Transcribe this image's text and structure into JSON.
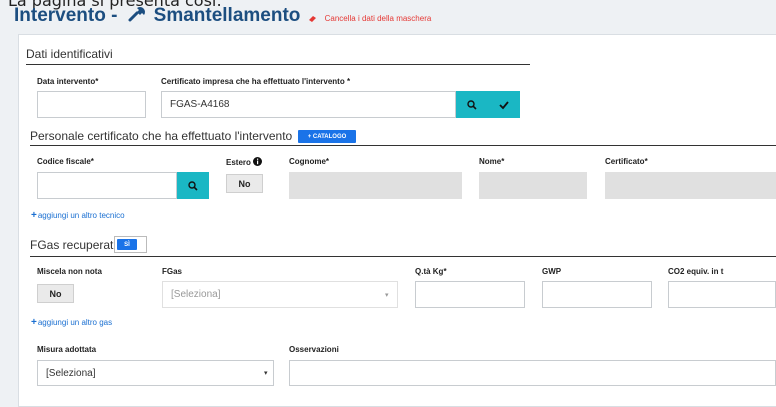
{
  "top_cut_text": "La pagina si presenta così:",
  "header": {
    "title_left": "Intervento -",
    "title_right": "Smantellamento",
    "wrench_icon": "wrench-icon",
    "eraser_icon": "eraser-icon",
    "clear_link": "Cancella i dati della maschera",
    "accent": "#1c4e80",
    "danger": "#e53935"
  },
  "dati": {
    "section_title": "Dati identificativi",
    "data_label": "Data intervento*",
    "data_value": "",
    "cert_label": "Certificato impresa che ha effettuato l'intervento *",
    "cert_value": "FGAS-A4168"
  },
  "personale": {
    "section_title": "Personale certificato che ha effettuato l'intervento",
    "catalog_button": "+ CATALOGO",
    "codice_label": "Codice fiscale*",
    "estero_label": "Estero",
    "estero_value": "No",
    "cognome_label": "Cognome*",
    "nome_label": "Nome*",
    "certificato_label": "Certificato*",
    "add_link": "aggiungi un altro tecnico"
  },
  "fgas": {
    "section_title": "FGas recuperati",
    "toggle_value": "SÌ",
    "miscela_label": "Miscela non nota",
    "miscela_value": "No",
    "fgas_label": "FGas",
    "fgas_placeholder": "[Seleziona]",
    "qta_label": "Q.tà Kg*",
    "gwp_label": "GWP",
    "co2_label": "CO2 equiv. in t",
    "add_link": "aggiungi un altro gas"
  },
  "misura": {
    "misura_label": "Misura adottata",
    "misura_value": "[Seleziona]",
    "osservazioni_label": "Osservazioni",
    "osservazioni_value": ""
  },
  "colors": {
    "teal": "#1ab7c4",
    "blue": "#1a73e8",
    "link": "#1a6fd1"
  }
}
